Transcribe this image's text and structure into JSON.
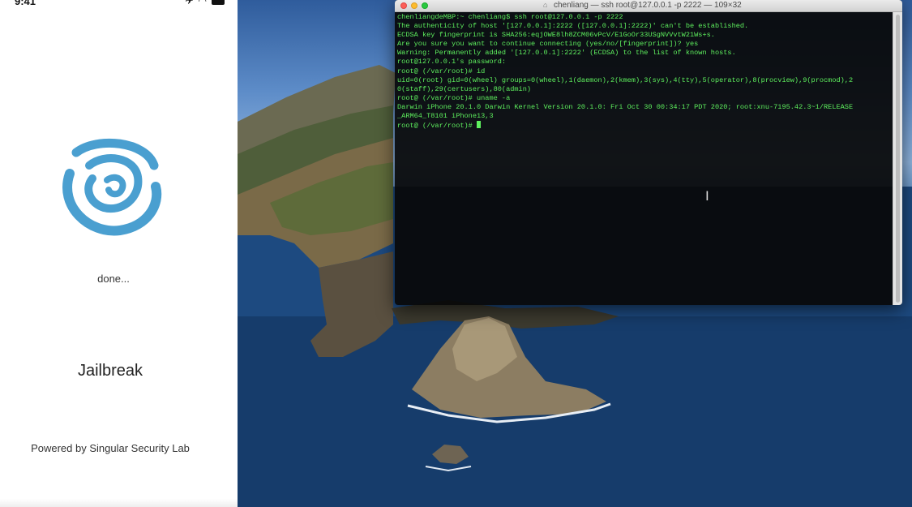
{
  "phone": {
    "status_time": "9:41",
    "progress_text": "done...",
    "jailbreak_label": "Jailbreak",
    "credit_text": "Powered by Singular Security Lab"
  },
  "terminal": {
    "title": "chenliang — ssh root@127.0.0.1 -p 2222 — 109×32",
    "lines": [
      "chenliangdeMBP:~ chenliang$ ssh root@127.0.0.1 -p 2222",
      "The authenticity of host '[127.0.0.1]:2222 ([127.0.0.1]:2222)' can't be established.",
      "ECDSA key fingerprint is SHA256:eqjOWE8lh8ZCM06vPcV/E1GoOr33USgNVVvtW21Ws+s.",
      "Are you sure you want to continue connecting (yes/no/[fingerprint])? yes",
      "Warning: Permanently added '[127.0.0.1]:2222' (ECDSA) to the list of known hosts.",
      "root@127.0.0.1's password:",
      "root@ (/var/root)# id",
      "uid=0(root) gid=0(wheel) groups=0(wheel),1(daemon),2(kmem),3(sys),4(tty),5(operator),8(procview),9(procmod),2",
      "0(staff),29(certusers),80(admin)",
      "root@ (/var/root)# uname -a",
      "Darwin iPhone 20.1.0 Darwin Kernel Version 20.1.0: Fri Oct 30 00:34:17 PDT 2020; root:xnu-7195.42.3~1/RELEASE",
      "_ARM64_T8101 iPhone13,3",
      "root@ (/var/root)# "
    ]
  },
  "colors": {
    "terminal_text": "#5ef05e",
    "logo_blue": "#4a9fd0"
  }
}
